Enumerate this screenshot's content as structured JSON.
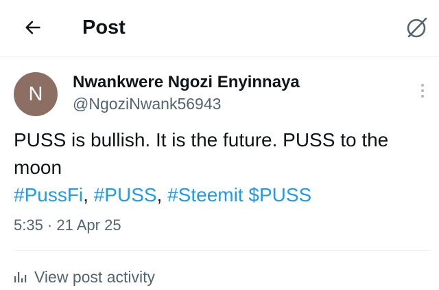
{
  "header": {
    "back_icon": "arrow-left-icon",
    "title": "Post",
    "grok_icon": "grok-icon"
  },
  "post": {
    "avatar_letter": "N",
    "avatar_color": "#8d6e63",
    "display_name": "Nwankwere Ngozi Enyinnaya",
    "handle": "@NgoziNwank56943",
    "text": "PUSS is bullish. It is the future. PUSS to the moon",
    "tags": [
      {
        "text": "#PussFi",
        "sep": ", "
      },
      {
        "text": "#PUSS",
        "sep": ", "
      },
      {
        "text": "#Steemit",
        "sep": " "
      },
      {
        "text": "$PUSS",
        "sep": ""
      }
    ],
    "timestamp": "5:35 · 21 Apr 25",
    "link_color": "#1d9bf0"
  },
  "footer": {
    "activity_icon": "bar-chart-icon",
    "activity_label": "View post activity"
  }
}
